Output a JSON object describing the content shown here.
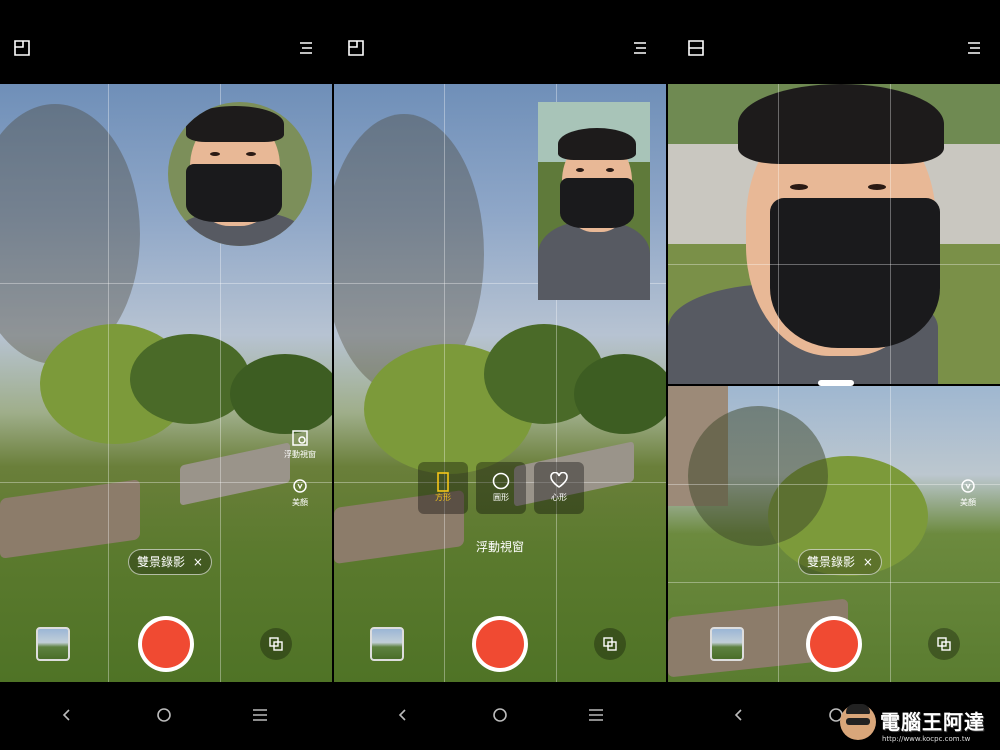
{
  "screens": [
    {
      "mode_pill": "雙景錄影",
      "pill_close": "×",
      "side_controls": [
        {
          "label": "浮動視窗",
          "icon": "floating-window-icon"
        },
        {
          "label": "美顏",
          "icon": "beauty-icon"
        }
      ],
      "pip_shape": "circle"
    },
    {
      "shape_options": [
        {
          "label": "方形",
          "icon": "square-shape-icon",
          "selected": true
        },
        {
          "label": "圓形",
          "icon": "circle-shape-icon",
          "selected": false
        },
        {
          "label": "心形",
          "icon": "heart-shape-icon",
          "selected": false
        }
      ],
      "panel_title": "浮動視窗",
      "pip_shape": "rectangle"
    },
    {
      "mode_pill": "雙景錄影",
      "pill_close": "×",
      "side_controls": [
        {
          "label": "美顏",
          "icon": "beauty-icon"
        }
      ],
      "layout": "split-vertical"
    }
  ],
  "watermark": {
    "title": "電腦王阿達",
    "url": "http://www.kocpc.com.tw"
  },
  "colors": {
    "shutter": "#f04a32",
    "selected_accent": "#f5c518"
  }
}
